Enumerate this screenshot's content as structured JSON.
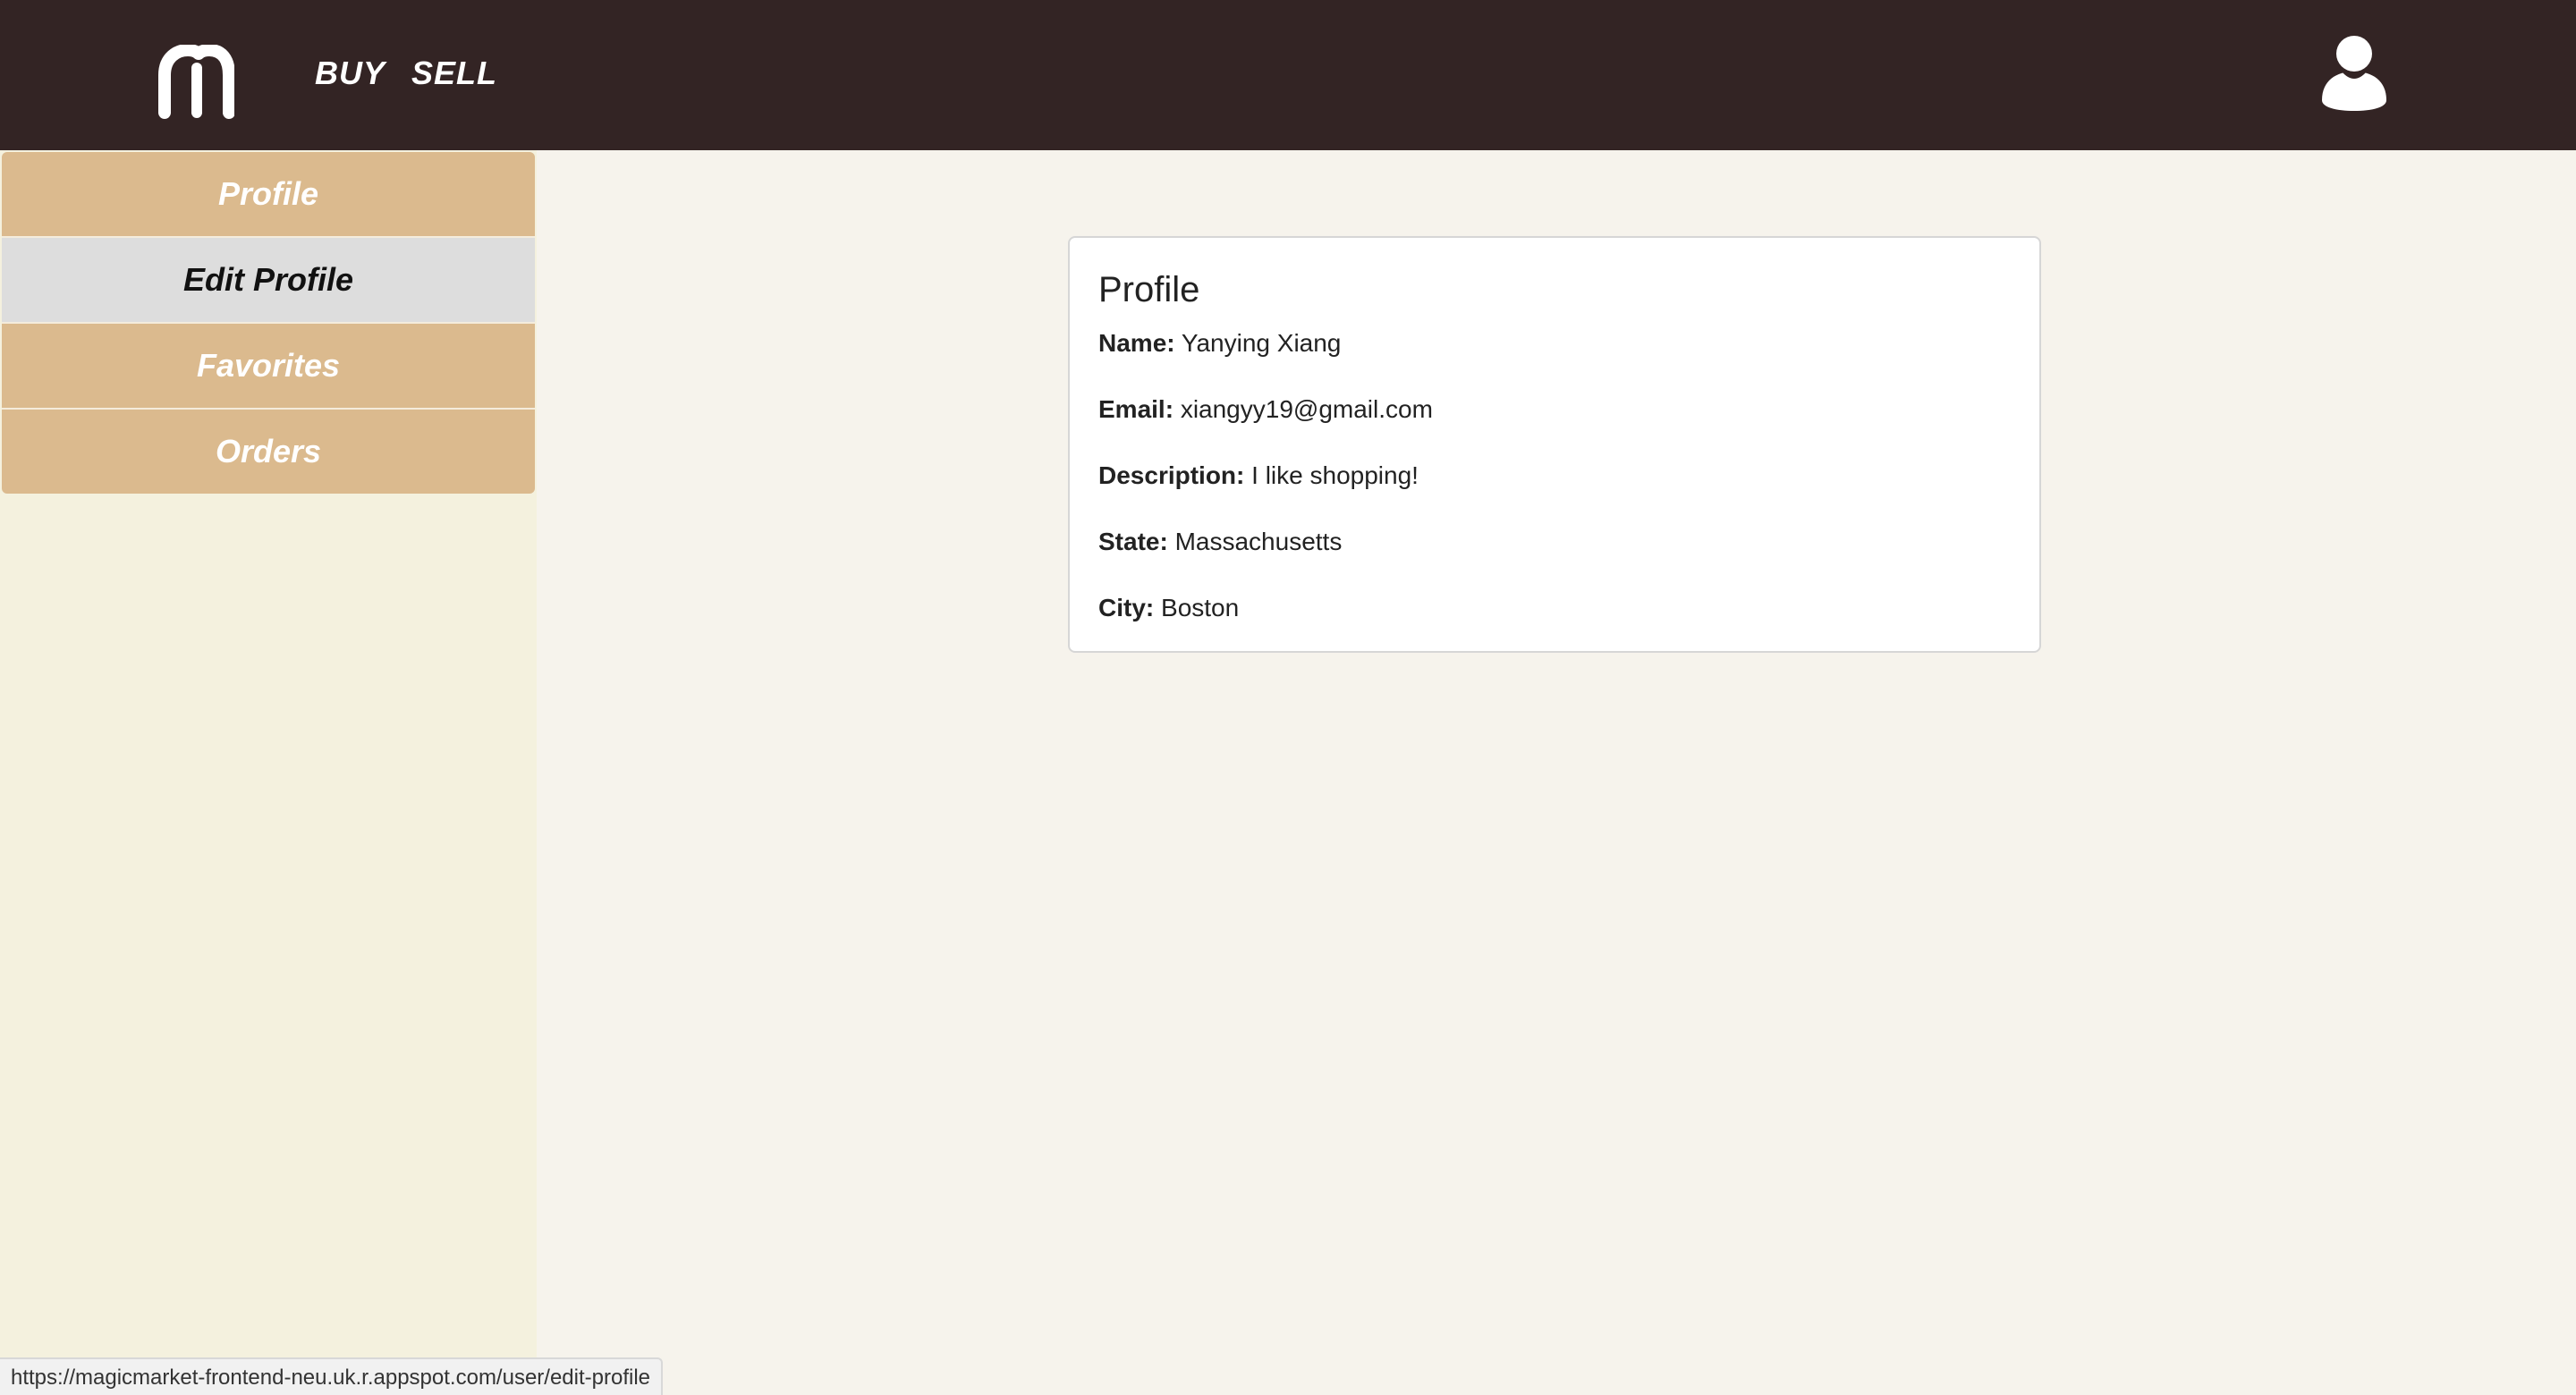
{
  "header": {
    "logo_icon": "magic-market-m-logo-icon",
    "nav": [
      {
        "label": "BUY"
      },
      {
        "label": "SELL"
      }
    ],
    "user_icon": "user-avatar-icon",
    "bg_color": "#332424"
  },
  "sidebar": {
    "items": [
      {
        "label": "Profile",
        "active": false
      },
      {
        "label": "Edit Profile",
        "active": true
      },
      {
        "label": "Favorites",
        "active": false
      },
      {
        "label": "Orders",
        "active": false
      }
    ],
    "item_color": "#dbba8e",
    "active_color": "#dddddd"
  },
  "profile_card": {
    "title": "Profile",
    "fields": [
      {
        "label": "Name:",
        "value": "Yanying Xiang"
      },
      {
        "label": "Email:",
        "value": "xiangyy19@gmail.com"
      },
      {
        "label": "Description:",
        "value": "I like shopping!"
      },
      {
        "label": "State:",
        "value": "Massachusetts"
      },
      {
        "label": "City:",
        "value": "Boston"
      }
    ]
  },
  "status_bar": {
    "url": "https://magicmarket-frontend-neu.uk.r.appspot.com/user/edit-profile"
  }
}
